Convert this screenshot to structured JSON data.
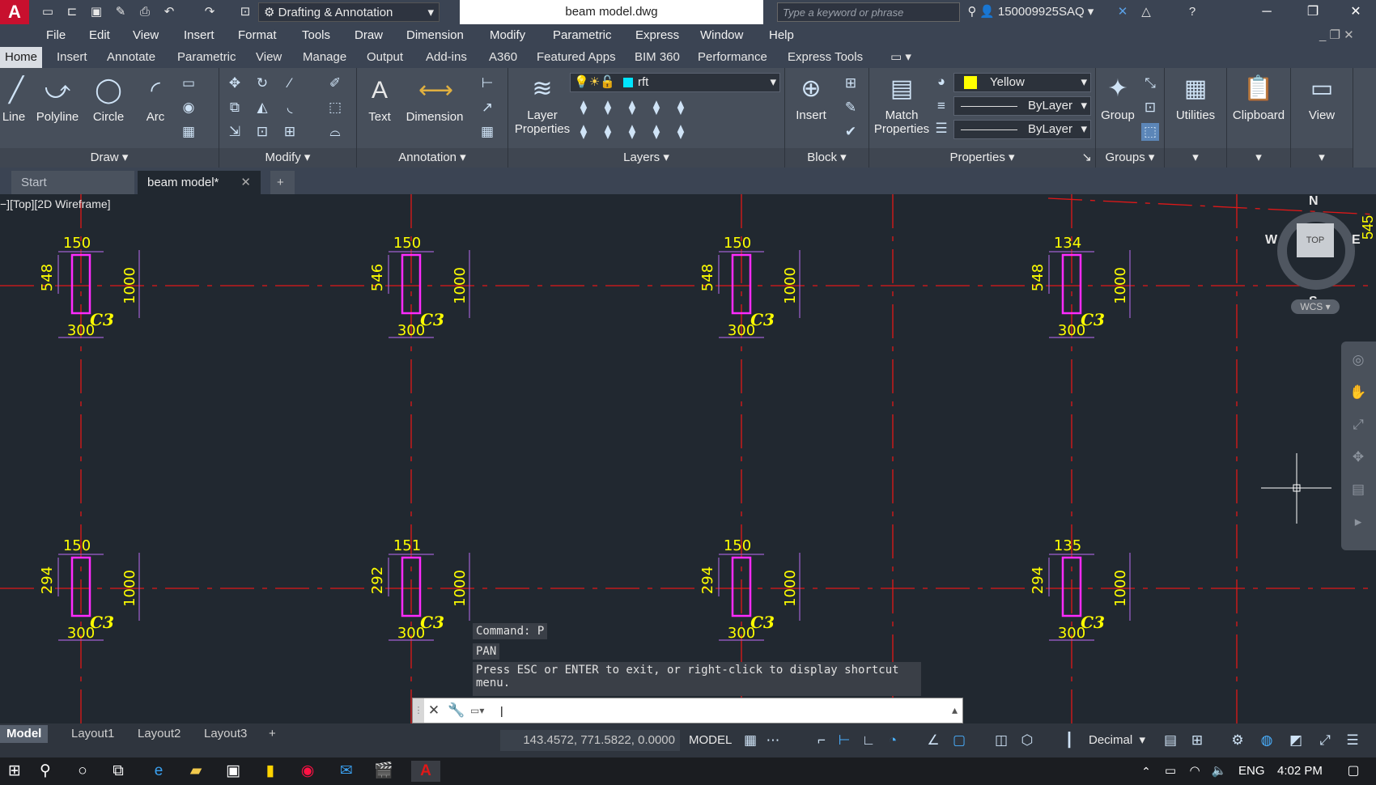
{
  "titlebar": {
    "workspace": "Drafting & Annotation",
    "document_title": "beam model.dwg",
    "search_placeholder": "Type a keyword or phrase",
    "username": "150009925SAQ"
  },
  "menubar": [
    "File",
    "Edit",
    "View",
    "Insert",
    "Format",
    "Tools",
    "Draw",
    "Dimension",
    "Modify",
    "Parametric",
    "Express",
    "Window",
    "Help"
  ],
  "ribbon_tabs": [
    "Home",
    "Insert",
    "Annotate",
    "Parametric",
    "View",
    "Manage",
    "Output",
    "Add-ins",
    "A360",
    "Featured Apps",
    "BIM 360",
    "Performance",
    "Express Tools"
  ],
  "ribbon": {
    "draw": {
      "title": "Draw",
      "line": "Line",
      "polyline": "Polyline",
      "circle": "Circle",
      "arc": "Arc"
    },
    "modify": {
      "title": "Modify"
    },
    "annotation": {
      "title": "Annotation",
      "text": "Text",
      "dimension": "Dimension"
    },
    "layers": {
      "title": "Layers",
      "layer_properties_1": "Layer",
      "layer_properties_2": "Properties",
      "current_layer": "rft"
    },
    "block": {
      "title": "Block",
      "insert": "Insert"
    },
    "properties": {
      "title": "Properties",
      "match_1": "Match",
      "match_2": "Properties",
      "color": "Yellow",
      "linetype": "ByLayer",
      "lineweight": "ByLayer"
    },
    "groups": {
      "title": "Groups",
      "group": "Group"
    },
    "utilities": "Utilities",
    "clipboard": "Clipboard",
    "view": "View"
  },
  "file_tabs": {
    "start": "Start",
    "active": "beam model*"
  },
  "viewport_label": "−][Top][2D Wireframe]",
  "viewcube": {
    "top": "TOP",
    "n": "N",
    "s": "S",
    "e": "E",
    "w": "W",
    "wcs": "WCS"
  },
  "columns_row1": [
    {
      "top": "150",
      "left": "548",
      "right": "1000",
      "bottom": "300",
      "tag": "C3"
    },
    {
      "top": "150",
      "left": "546",
      "right": "1000",
      "bottom": "300",
      "tag": "C3"
    },
    {
      "top": "150",
      "left": "548",
      "right": "1000",
      "bottom": "300",
      "tag": "C3"
    },
    {
      "top": "134",
      "left": "548",
      "right": "1000",
      "bottom": "300",
      "tag": "C3"
    }
  ],
  "columns_row2": [
    {
      "top": "150",
      "left": "294",
      "right": "1000",
      "bottom": "300",
      "tag": "C3"
    },
    {
      "top": "151",
      "left": "292",
      "right": "1000",
      "bottom": "300",
      "tag": "C3"
    },
    {
      "top": "150",
      "left": "294",
      "right": "1000",
      "bottom": "300",
      "tag": "C3"
    },
    {
      "top": "135",
      "left": "294",
      "right": "1000",
      "bottom": "300",
      "tag": "C3"
    }
  ],
  "edge_labels": {
    "right_row1": "545"
  },
  "command": {
    "history1": "Command: P",
    "history2": "PAN",
    "history3a": "Press ESC or ENTER to exit, or right-click to display shortcut",
    "history3b": "menu."
  },
  "layout_tabs": [
    "Model",
    "Layout1",
    "Layout2",
    "Layout3"
  ],
  "status": {
    "coords": "143.4572, 771.5822, 0.0000",
    "model": "MODEL",
    "units": "Decimal"
  },
  "taskbar": {
    "lang": "ENG",
    "time": "4:02 PM"
  }
}
